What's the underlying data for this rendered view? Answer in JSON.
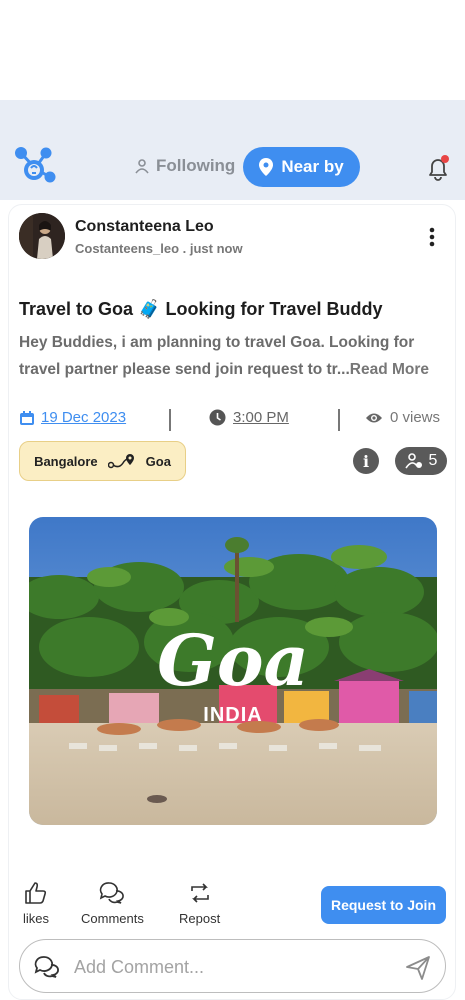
{
  "header": {
    "tabs": [
      {
        "label": "Following",
        "active": false
      },
      {
        "label": "Near by",
        "active": true
      }
    ],
    "notification_dot": true
  },
  "post": {
    "author_name": "Constanteena Leo",
    "author_meta": "Costanteens_leo . just now",
    "title": "Travel to Goa 🧳 Looking for Travel Buddy",
    "body": "Hey Buddies, i am planning to travel Goa. Looking for travel partner please send join request to tr...",
    "read_more": "Read More",
    "date": "19 Dec 2023",
    "time": "3:00 PM",
    "views": "0 views",
    "route_from": "Bangalore",
    "route_to": "Goa",
    "members_count": "5",
    "image_caption_main": "Goa",
    "image_caption_sub": "INDIA"
  },
  "actions": {
    "likes": "likes",
    "comments": "Comments",
    "repost": "Repost",
    "request": "Request to Join"
  },
  "comment": {
    "placeholder": "Add Comment..."
  },
  "colors": {
    "accent": "#3f8ef0",
    "header_bg": "#e8edf5",
    "route_bg": "#fbeec4",
    "notification": "#e84545"
  }
}
